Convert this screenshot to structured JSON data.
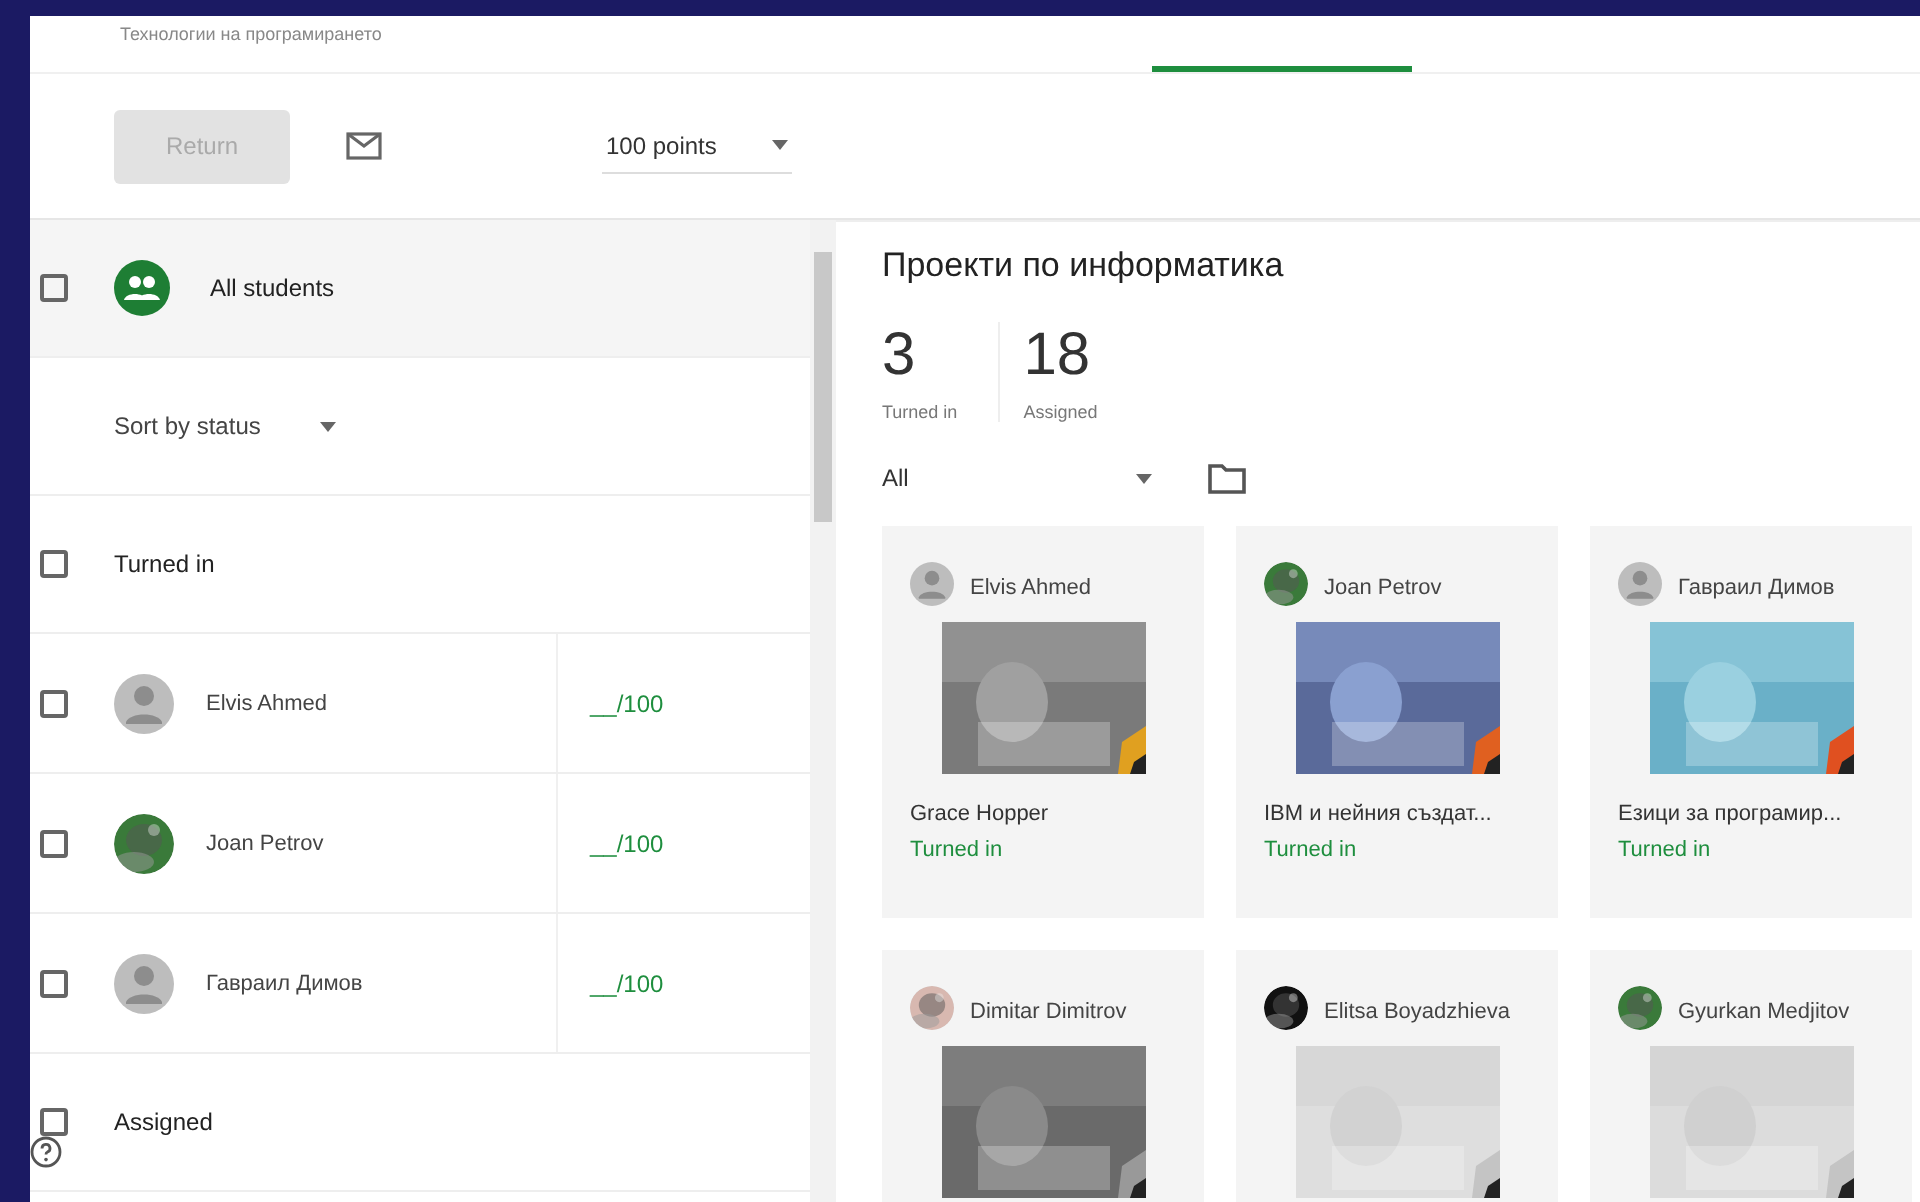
{
  "header": {
    "breadcrumb": "Технологии на програмирането"
  },
  "toolbar": {
    "return_button": {
      "label": "Return",
      "disabled": true
    },
    "points": {
      "value": "100 points"
    }
  },
  "students": {
    "all": {
      "label": "All students",
      "checked": false
    },
    "sort": {
      "label": "Sort by status"
    },
    "groups": [
      {
        "label": "Turned in",
        "checked": false,
        "students": [
          {
            "name": "Elvis Ahmed",
            "avatar": {
              "kind": "default"
            },
            "grade": "__/100",
            "checked": false
          },
          {
            "name": "Joan Petrov",
            "grade": "__/100",
            "checked": false
          },
          {
            "name": "Гавраил Димов",
            "avatar": {
              "kind": "default"
            },
            "grade": "__/100",
            "checked": false
          }
        ]
      },
      {
        "label": "Assigned",
        "checked": false
      }
    ]
  },
  "assignment": {
    "title": "Проекти по информатика",
    "stats": [
      {
        "value": "3",
        "label": "Turned in"
      },
      {
        "value": "18",
        "label": "Assigned"
      }
    ],
    "filter": {
      "value": "All"
    },
    "submissions": [
      {
        "student": "Elvis Ahmed",
        "avatar": {
          "kind": "default"
        },
        "title": "Grace Hopper",
        "status": "Turned in"
      },
      {
        "student": "Joan Petrov",
        "title": "IBM и нейния създат...",
        "status": "Turned in"
      },
      {
        "student": "Гавраил Димов",
        "avatar": {
          "kind": "default"
        },
        "title": "Езици за програмир...",
        "status": "Turned in"
      },
      {
        "student": "Dimitar Dimitrov"
      },
      {
        "student": "Elitsa Boyadzhieva"
      },
      {
        "student": "Gyurkan Medjitov"
      }
    ]
  }
}
